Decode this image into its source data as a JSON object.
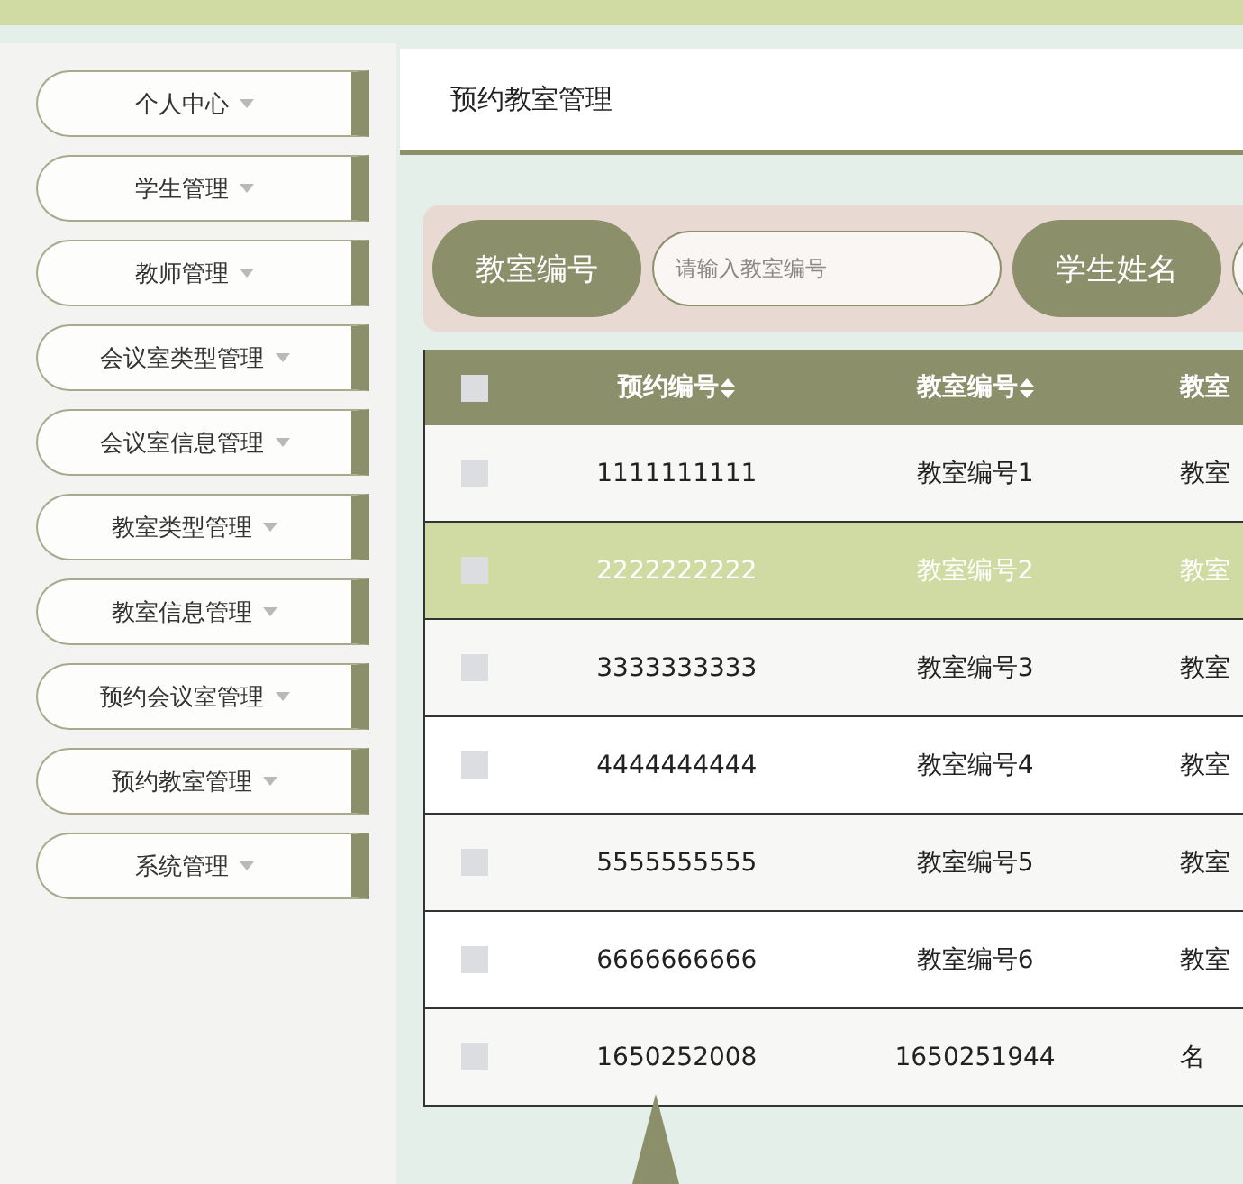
{
  "sidebar": {
    "items": [
      {
        "label": "个人中心",
        "expanded": false
      },
      {
        "label": "学生管理",
        "expanded": false
      },
      {
        "label": "教师管理",
        "expanded": false
      },
      {
        "label": "会议室类型管理",
        "expanded": false
      },
      {
        "label": "会议室信息管理",
        "expanded": false
      },
      {
        "label": "教室类型管理",
        "expanded": false
      },
      {
        "label": "教室信息管理",
        "expanded": false
      },
      {
        "label": "预约会议室管理",
        "expanded": false
      },
      {
        "label": "预约教室管理",
        "expanded": false
      },
      {
        "label": "系统管理",
        "expanded": false
      }
    ]
  },
  "header": {
    "title": "预约教室管理"
  },
  "search": {
    "fields": [
      {
        "label": "教室编号",
        "placeholder": "请输入教室编号"
      },
      {
        "label": "学生姓名"
      }
    ]
  },
  "table": {
    "select_all": {
      "checked": false
    },
    "columns": [
      {
        "label": "预约编号",
        "sortable": true
      },
      {
        "label": "教室编号",
        "sortable": true
      },
      {
        "label": "教室",
        "sortable": false
      }
    ],
    "rows": [
      {
        "selected": false,
        "checked": false,
        "cells": [
          "1111111111",
          "教室编号1",
          "教室"
        ]
      },
      {
        "selected": true,
        "checked": false,
        "cells": [
          "2222222222",
          "教室编号2",
          "教室"
        ]
      },
      {
        "selected": false,
        "checked": false,
        "cells": [
          "3333333333",
          "教室编号3",
          "教室"
        ]
      },
      {
        "selected": false,
        "checked": false,
        "cells": [
          "4444444444",
          "教室编号4",
          "教室"
        ]
      },
      {
        "selected": false,
        "checked": false,
        "cells": [
          "5555555555",
          "教室编号5",
          "教室"
        ]
      },
      {
        "selected": false,
        "checked": false,
        "cells": [
          "6666666666",
          "教室编号6",
          "教室"
        ]
      },
      {
        "selected": false,
        "checked": false,
        "cells": [
          "1650252008",
          "1650251944",
          "名"
        ]
      }
    ]
  }
}
